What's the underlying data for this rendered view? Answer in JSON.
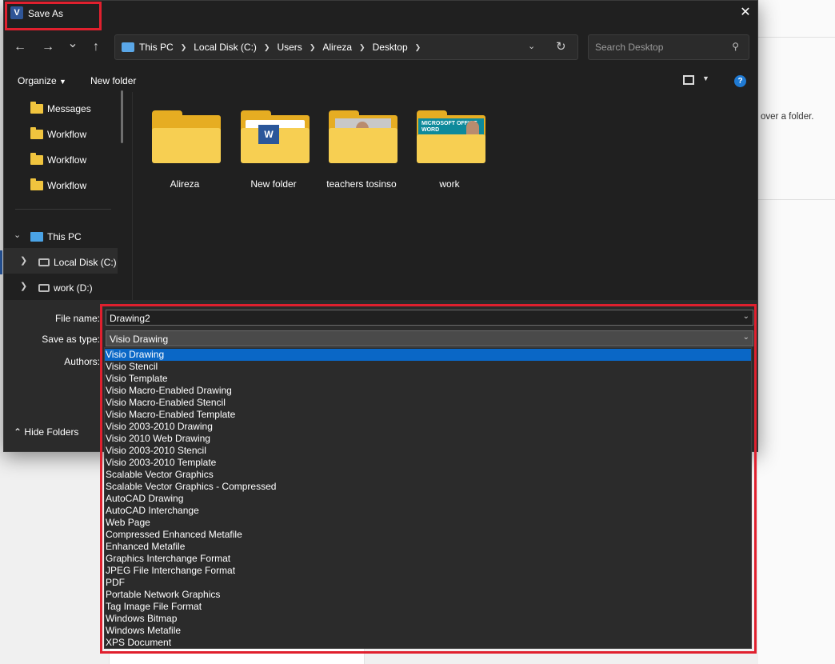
{
  "background": {
    "hint_text": "over a folder."
  },
  "dialog": {
    "title": "Save As",
    "app_icon_letter": "V",
    "close_glyph": "✕"
  },
  "nav": {
    "back_glyph": "←",
    "forward_glyph": "→",
    "recent_glyph": "⌄",
    "up_glyph": "↑",
    "breadcrumbs": [
      "This PC",
      "Local Disk (C:)",
      "Users",
      "Alireza",
      "Desktop"
    ],
    "search_placeholder": "Search Desktop"
  },
  "toolbar": {
    "organize_label": "Organize",
    "new_folder_label": "New folder"
  },
  "sidebar": {
    "items": [
      {
        "label": "Messages"
      },
      {
        "label": "Workflow"
      },
      {
        "label": "Workflow"
      },
      {
        "label": "Workflow"
      },
      {
        "label": "This PC"
      },
      {
        "label": "Local Disk (C:)"
      },
      {
        "label": "work (D:)"
      }
    ]
  },
  "files": [
    {
      "name": "Alireza"
    },
    {
      "name": "New folder",
      "thumb_text": "W"
    },
    {
      "name": "teachers tosinso"
    },
    {
      "name": "work",
      "thumb_text": "MICROSOFT OFFICE WORD"
    }
  ],
  "form": {
    "file_name_label": "File name:",
    "file_name_value": "Drawing2",
    "save_type_label": "Save as type:",
    "save_type_value": "Visio Drawing",
    "authors_label": "Authors:",
    "hide_folders_label": "Hide Folders"
  },
  "save_types": [
    "Visio Drawing",
    "Visio Stencil",
    "Visio Template",
    "Visio Macro-Enabled Drawing",
    "Visio Macro-Enabled Stencil",
    "Visio Macro-Enabled Template",
    "Visio 2003-2010 Drawing",
    "Visio 2010 Web Drawing",
    "Visio 2003-2010 Stencil",
    "Visio 2003-2010 Template",
    "Scalable Vector Graphics",
    "Scalable Vector Graphics - Compressed",
    "AutoCAD Drawing",
    "AutoCAD Interchange",
    "Web Page",
    "Compressed Enhanced Metafile",
    "Enhanced Metafile",
    "Graphics Interchange Format",
    "JPEG File Interchange Format",
    "PDF",
    "Portable Network Graphics",
    "Tag Image File Format",
    "Windows Bitmap",
    "Windows Metafile",
    "XPS Document"
  ],
  "colors": {
    "highlight": "#e0202e",
    "selection": "#0a67c6",
    "dialog_bg": "#202020"
  }
}
